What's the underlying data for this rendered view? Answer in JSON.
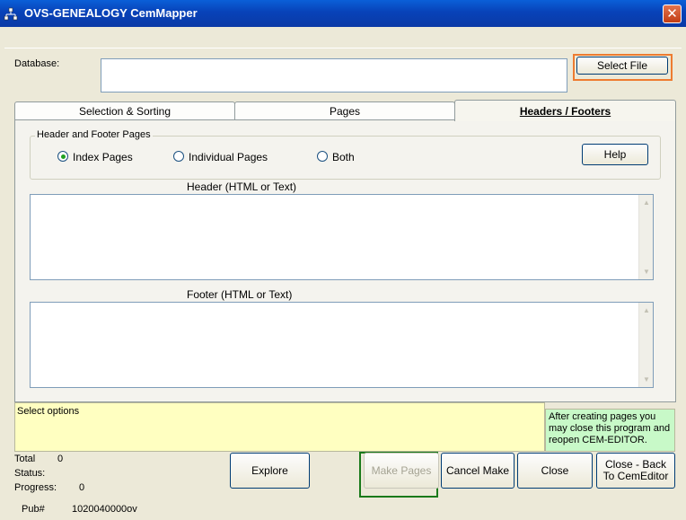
{
  "window": {
    "title": "OVS-GENEALOGY  CemMapper",
    "app_icon": "family-tree-icon",
    "close_glyph": "✕"
  },
  "database": {
    "label": "Database:",
    "value": "",
    "select_file_label": "Select File"
  },
  "tabs": [
    {
      "label": "Selection & Sorting",
      "active": false
    },
    {
      "label": "Pages",
      "active": false
    },
    {
      "label": "Headers / Footers",
      "active": true
    }
  ],
  "header_footer_group": {
    "title": "Header and Footer Pages",
    "options": [
      {
        "label": "Index Pages",
        "selected": true
      },
      {
        "label": "Individual Pages",
        "selected": false
      },
      {
        "label": "Both",
        "selected": false
      }
    ],
    "help_label": "Help"
  },
  "header_section": {
    "label": "Header (HTML or Text)",
    "value": ""
  },
  "footer_section": {
    "label": "Footer (HTML or Text)",
    "value": ""
  },
  "status_box": {
    "text": "Select options"
  },
  "note_box": {
    "text": "After creating pages you may close this program and reopen CEM-EDITOR."
  },
  "stats": {
    "total_label": "Total",
    "total_value": "0",
    "status_label": "Status:",
    "status_value": "",
    "progress_label": "Progress:",
    "progress_value": "0",
    "pub_label": "Pub#",
    "pub_value": "1020040000ov"
  },
  "buttons": {
    "explore": "Explore",
    "make_pages": "Make Pages",
    "cancel_make": "Cancel Make",
    "close": "Close",
    "close_back": "Close - Back To CemEditor"
  },
  "colors": {
    "title_bar": "#0a4fc8",
    "status_bg": "#ffffc1",
    "note_bg": "#c8f9c8",
    "highlight_select_file": "#ee7c31",
    "highlight_make_pages": "#1a7a1a"
  }
}
